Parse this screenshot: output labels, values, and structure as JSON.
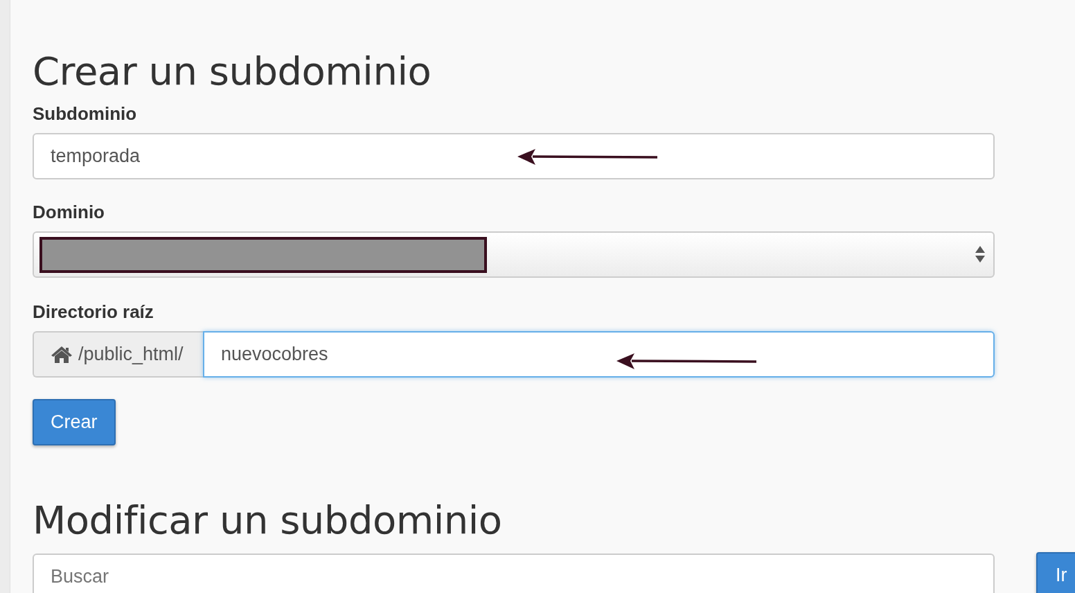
{
  "create_section": {
    "title": "Crear un subdominio",
    "subdomain": {
      "label": "Subdominio",
      "value": "temporada",
      "annotated": true
    },
    "domain": {
      "label": "Dominio",
      "redacted": true
    },
    "document_root": {
      "label": "Directorio raíz",
      "prefix": "/public_html/",
      "value": "nuevocobres",
      "focused": true,
      "annotated": true
    },
    "submit_button": "Crear"
  },
  "modify_section": {
    "title": "Modificar un subdominio",
    "search": {
      "placeholder": "Buscar"
    },
    "go_button": "Ir"
  }
}
